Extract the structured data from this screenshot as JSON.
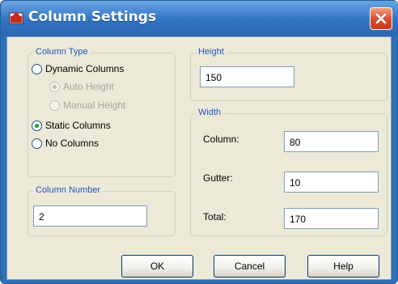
{
  "window": {
    "title": "Column Settings",
    "icon": "column-settings-icon"
  },
  "column_type": {
    "title": "Column Type",
    "options": {
      "dynamic": {
        "label": "Dynamic Columns",
        "selected": false
      },
      "auto_height": {
        "label": "Auto Height",
        "selected": true,
        "enabled": false
      },
      "manual_height": {
        "label": "Manual Height",
        "selected": false,
        "enabled": false
      },
      "static": {
        "label": "Static Columns",
        "selected": true
      },
      "none": {
        "label": "No Columns",
        "selected": false
      }
    }
  },
  "column_number": {
    "title": "Column Number",
    "value": "2"
  },
  "height": {
    "title": "Height",
    "value": "150"
  },
  "width": {
    "title": "Width",
    "column": {
      "label": "Column:",
      "value": "80"
    },
    "gutter": {
      "label": "Gutter:",
      "value": "10"
    },
    "total": {
      "label": "Total:",
      "value": "170"
    }
  },
  "buttons": {
    "ok": "OK",
    "cancel": "Cancel",
    "help": "Help"
  },
  "colors": {
    "group_title": "#1f57c2",
    "titlebar": "#2f73c3",
    "close": "#d8492a",
    "dialog_bg": "#ece9d8"
  }
}
